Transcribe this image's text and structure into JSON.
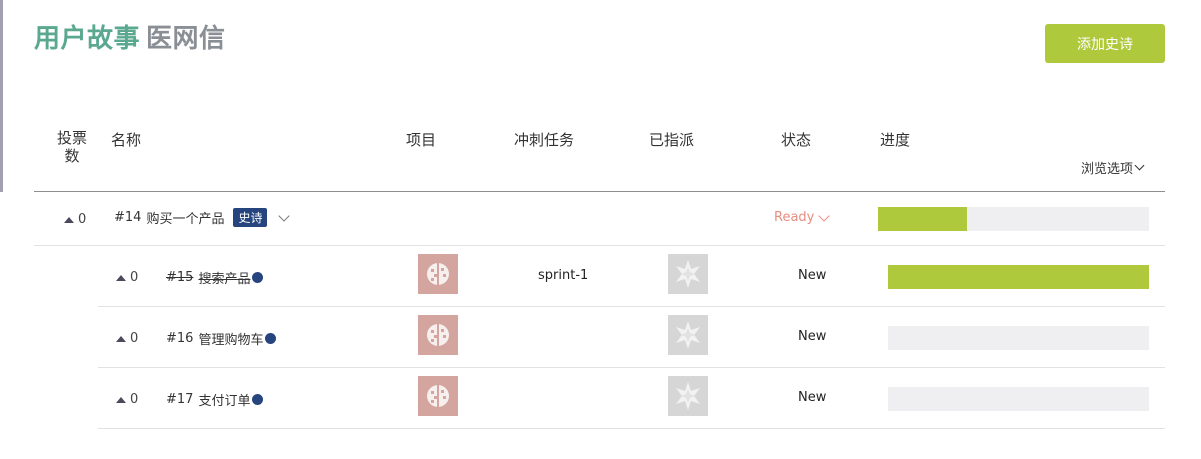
{
  "header": {
    "title_main": "用户故事",
    "title_project": "医网信",
    "add_button": "添加史诗"
  },
  "columns": {
    "votes": "投票数",
    "name": "名称",
    "project": "项目",
    "sprint": "冲刺任务",
    "assigned": "已指派",
    "status": "状态",
    "progress": "进度",
    "browse_options": "浏览选项"
  },
  "epic": {
    "votes": "0",
    "ref": "#14",
    "title": "购买一个产品",
    "badge": "史诗",
    "status": "Ready",
    "progress": 0.33
  },
  "stories": [
    {
      "votes": "0",
      "ref": "#15",
      "title": "搜索产品",
      "closed": true,
      "sprint": "sprint-1",
      "status": "New",
      "progress": 1.0,
      "project_icon": "project-avatar-icon",
      "assignee_icon": "default-avatar-icon"
    },
    {
      "votes": "0",
      "ref": "#16",
      "title": "管理购物车",
      "closed": false,
      "sprint": "",
      "status": "New",
      "progress": 0.0,
      "project_icon": "project-avatar-icon",
      "assignee_icon": "default-avatar-icon"
    },
    {
      "votes": "0",
      "ref": "#17",
      "title": "支付订单",
      "closed": false,
      "sprint": "",
      "status": "New",
      "progress": 0.0,
      "project_icon": "project-avatar-icon",
      "assignee_icon": "default-avatar-icon"
    }
  ],
  "colors": {
    "accent_green": "#aec93b",
    "title_green": "#5aa88f",
    "badge_blue": "#26457e",
    "ready_status": "#e98d7f"
  }
}
